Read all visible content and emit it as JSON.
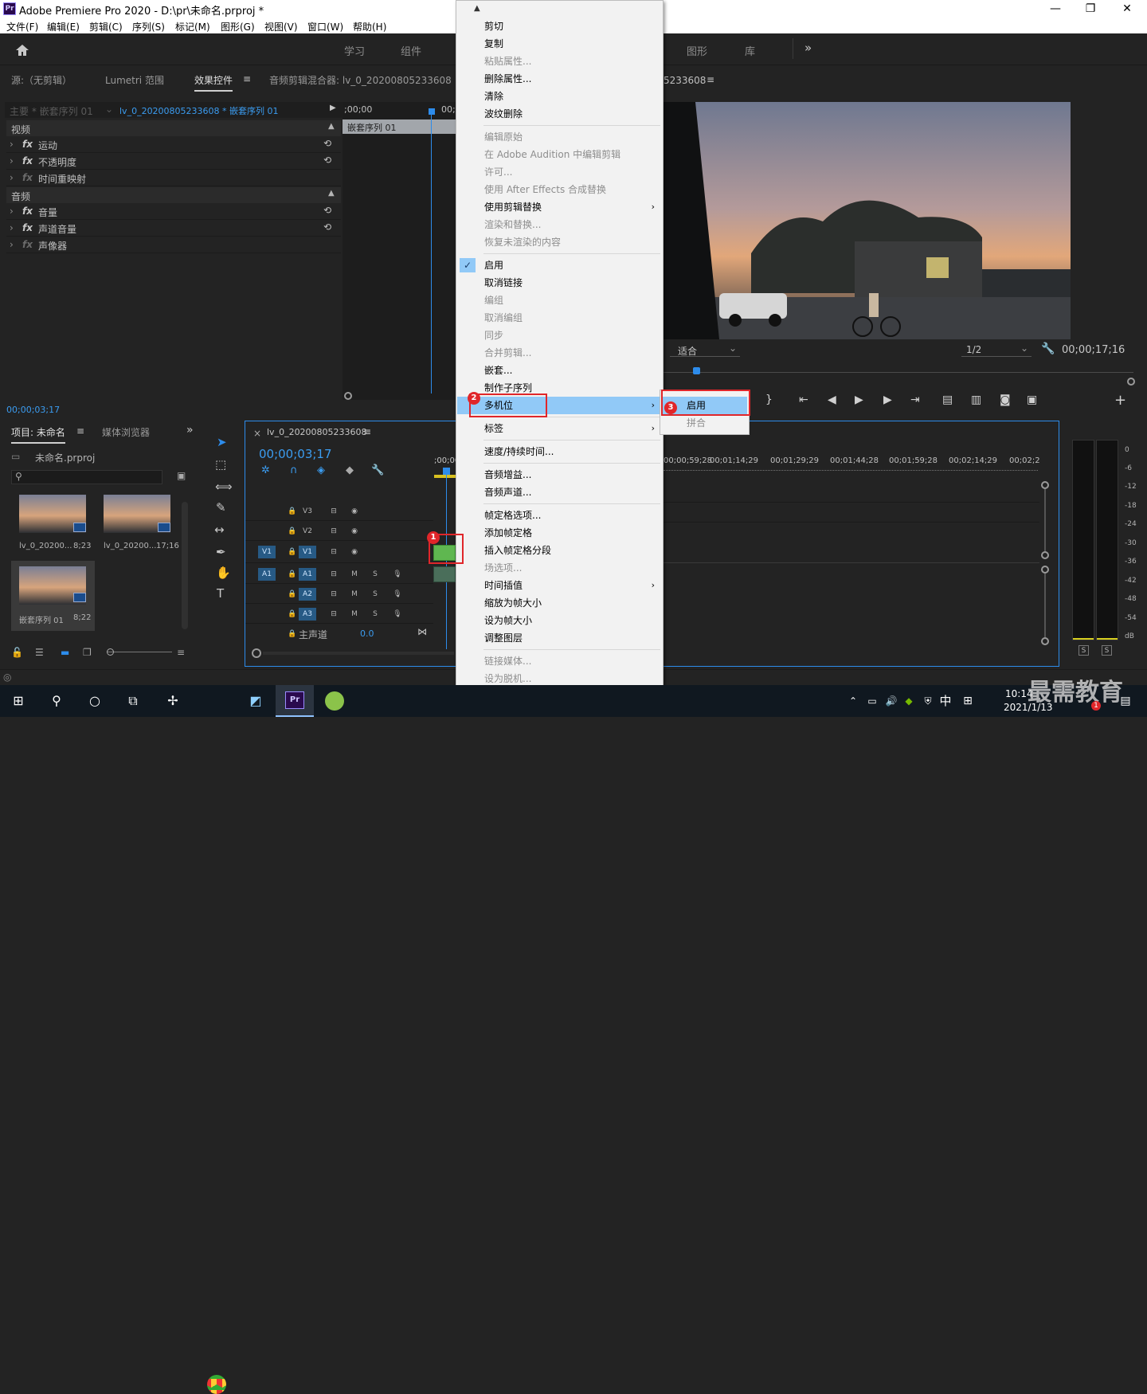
{
  "titlebar": {
    "title": "Adobe Premiere Pro 2020 - D:\\pr\\未命名.prproj *",
    "logo": "Pr",
    "minimize": "—",
    "maximize": "❐",
    "close": "✕"
  },
  "menubar": [
    "文件(F)",
    "编辑(E)",
    "剪辑(C)",
    "序列(S)",
    "标记(M)",
    "图形(G)",
    "视图(V)",
    "窗口(W)",
    "帮助(H)"
  ],
  "workspaces": [
    "学习",
    "组件",
    "图形",
    "库"
  ],
  "workspace_more": "»",
  "source_panel": {
    "tabs": [
      "源:（无剪辑）",
      "Lumetri 范围",
      "效果控件",
      "音频剪辑混合器: lv_0_20200805233608"
    ],
    "master": "主要 * 嵌套序列 01",
    "clip": "lv_0_20200805233608 * 嵌套序列 01",
    "tc_start": ";00;00",
    "tc_next": "00;",
    "nested_clip": "嵌套序列 01",
    "video_header": "视频",
    "audio_header": "音频",
    "video_effects": [
      "运动",
      "不透明度",
      "时间重映射"
    ],
    "audio_effects": [
      "音量",
      "声道音量",
      "声像器"
    ],
    "fx": "fx",
    "timecode": "00;00;03;17"
  },
  "program_panel": {
    "title_suffix": "5233608",
    "fit": "适合",
    "res": "1/2",
    "timecode": "00;00;17;16"
  },
  "project_panel": {
    "tabs": [
      "项目: 未命名",
      "媒体浏览器"
    ],
    "project_file": "未命名.prproj",
    "items": [
      {
        "name": "lv_0_20200...",
        "dur": "8;23"
      },
      {
        "name": "lv_0_20200...",
        "dur": "17;16"
      },
      {
        "name": "嵌套序列 01",
        "dur": "8;22"
      }
    ]
  },
  "timeline": {
    "tab": "lv_0_20200805233608",
    "timecode": "00;00;03;17",
    "ruler_start": ";00;00",
    "ruler": [
      "00;00;59;28",
      "00;01;14;29",
      "00;01;29;29",
      "00;01;44;28",
      "00;01;59;28",
      "00;02;14;29",
      "00;02;2"
    ],
    "tracks": [
      {
        "src": "",
        "name": "V3"
      },
      {
        "src": "",
        "name": "V2"
      },
      {
        "src": "V1",
        "name": "V1"
      },
      {
        "src": "A1",
        "name": "A1"
      },
      {
        "src": "",
        "name": "A2"
      },
      {
        "src": "",
        "name": "A3"
      }
    ],
    "master": "主声道",
    "master_val": "0.0",
    "mute": "M",
    "solo": "S"
  },
  "meter": {
    "labels": [
      "0",
      "-6",
      "-12",
      "-18",
      "-24",
      "-30",
      "-36",
      "-42",
      "-48",
      "-54",
      "dB"
    ],
    "s": "S"
  },
  "context_menu": [
    {
      "label": "剪切",
      "dis": false
    },
    {
      "label": "复制",
      "dis": false
    },
    {
      "label": "粘贴属性...",
      "dis": true
    },
    {
      "label": "删除属性...",
      "dis": false
    },
    {
      "label": "清除",
      "dis": false
    },
    {
      "label": "波纹删除",
      "dis": false
    },
    {
      "sep": true
    },
    {
      "label": "编辑原始",
      "dis": true
    },
    {
      "label": "在 Adobe Audition 中编辑剪辑",
      "dis": true
    },
    {
      "label": "许可...",
      "dis": true
    },
    {
      "label": "使用 After Effects 合成替换",
      "dis": true
    },
    {
      "label": "使用剪辑替换",
      "dis": false,
      "sub": true
    },
    {
      "label": "渲染和替换...",
      "dis": true
    },
    {
      "label": "恢复未渲染的内容",
      "dis": true
    },
    {
      "sep": true
    },
    {
      "label": "启用",
      "dis": false,
      "check": true
    },
    {
      "label": "取消链接",
      "dis": false
    },
    {
      "label": "编组",
      "dis": true
    },
    {
      "label": "取消编组",
      "dis": true
    },
    {
      "label": "同步",
      "dis": true
    },
    {
      "label": "合并剪辑...",
      "dis": true
    },
    {
      "label": "嵌套...",
      "dis": false
    },
    {
      "label": "制作子序列",
      "dis": false
    },
    {
      "label": "多机位",
      "dis": false,
      "sub": true,
      "hl": true
    },
    {
      "sep": true
    },
    {
      "label": "标签",
      "dis": false,
      "sub": true
    },
    {
      "sep": true
    },
    {
      "label": "速度/持续时间...",
      "dis": false
    },
    {
      "sep": true
    },
    {
      "label": "音频增益...",
      "dis": false
    },
    {
      "label": "音频声道...",
      "dis": false
    },
    {
      "sep": true
    },
    {
      "label": "帧定格选项...",
      "dis": false
    },
    {
      "label": "添加帧定格",
      "dis": false
    },
    {
      "label": "插入帧定格分段",
      "dis": false
    },
    {
      "label": "场选项...",
      "dis": true
    },
    {
      "label": "时间插值",
      "dis": false,
      "sub": true
    },
    {
      "label": "缩放为帧大小",
      "dis": false
    },
    {
      "label": "设为帧大小",
      "dis": false
    },
    {
      "label": "调整图层",
      "dis": false
    },
    {
      "sep": true
    },
    {
      "label": "链接媒体...",
      "dis": true
    },
    {
      "label": "设为脱机...",
      "dis": true
    }
  ],
  "submenu": [
    {
      "label": "启用",
      "hl": true
    },
    {
      "label": "拼合",
      "dis": true
    }
  ],
  "badges": [
    "1",
    "2",
    "3"
  ],
  "taskbar": {
    "time": "10:14",
    "date": "2021/1/13",
    "ime": "中",
    "watermark": "最需教育",
    "notif": "1"
  },
  "colors": {
    "accent": "#2d8ceb",
    "highlight": "#91c9f7",
    "annotation": "#e0262a",
    "clip_green": "#5fb750"
  }
}
